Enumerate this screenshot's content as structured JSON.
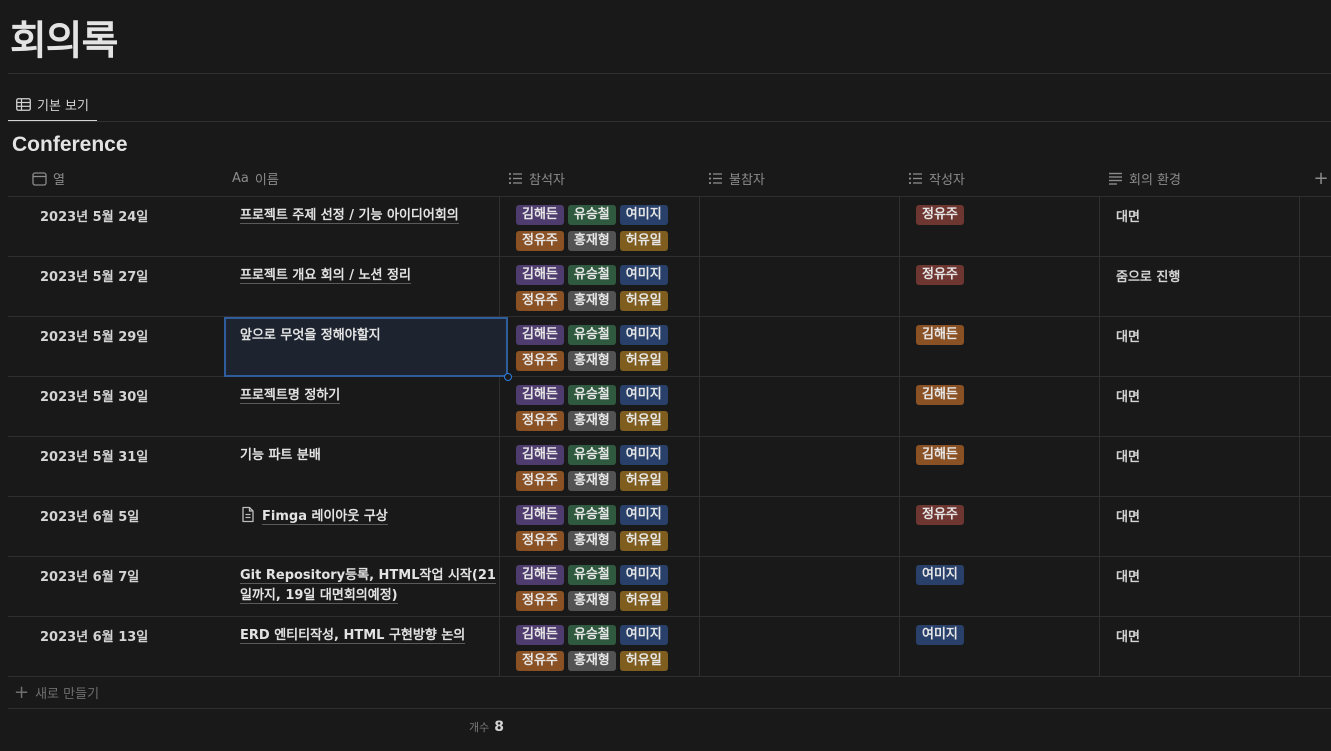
{
  "page": {
    "title": "회의록"
  },
  "tabs": [
    {
      "label": "기본 보기",
      "icon": "table-icon"
    }
  ],
  "database": {
    "title": "Conference"
  },
  "columns": [
    {
      "label": "열",
      "icon": "calendar-icon"
    },
    {
      "label": "이름",
      "icon": "text-aa-icon",
      "prefix": "Aa"
    },
    {
      "label": "참석자",
      "icon": "list-icon"
    },
    {
      "label": "불참자",
      "icon": "list-icon"
    },
    {
      "label": "작성자",
      "icon": "list-icon"
    },
    {
      "label": "회의 환경",
      "icon": "lines-icon"
    }
  ],
  "tag_colors": {
    "김해든": "#4e3c6e",
    "유승철": "#2f5a3f",
    "여미지": "#28406a",
    "정유주": "#8a5124",
    "홍재형": "#535353",
    "허유일": "#7f5d1f",
    "writer_정유주": "#6e3630",
    "writer_김해든": "#8a5124",
    "writer_여미지": "#28406a"
  },
  "rows": [
    {
      "date": "2023년 5월 24일",
      "name": "프로젝트 주제 선정 / 기능 아이디어회의",
      "attendees": [
        "김해든",
        "유승철",
        "여미지",
        "정유주",
        "홍재형",
        "허유일"
      ],
      "absentees": [],
      "writer": "정유주",
      "environment": "대면"
    },
    {
      "date": "2023년 5월 27일",
      "name": "프로젝트 개요 회의 / 노션 정리",
      "attendees": [
        "김해든",
        "유승철",
        "여미지",
        "정유주",
        "홍재형",
        "허유일"
      ],
      "absentees": [],
      "writer": "정유주",
      "environment": "줌으로 진행"
    },
    {
      "date": "2023년 5월 29일",
      "name": "앞으로 무엇을 정해야할지",
      "attendees": [
        "김해든",
        "유승철",
        "여미지",
        "정유주",
        "홍재형",
        "허유일"
      ],
      "absentees": [],
      "writer": "김해든",
      "environment": "대면"
    },
    {
      "date": "2023년 5월 30일",
      "name": "프로젝트명 정하기",
      "attendees": [
        "김해든",
        "유승철",
        "여미지",
        "정유주",
        "홍재형",
        "허유일"
      ],
      "absentees": [],
      "writer": "김해든",
      "environment": "대면"
    },
    {
      "date": "2023년 5월 31일",
      "name": "기능 파트 분배",
      "attendees": [
        "김해든",
        "유승철",
        "여미지",
        "정유주",
        "홍재형",
        "허유일"
      ],
      "absentees": [],
      "writer": "김해든",
      "environment": "대면"
    },
    {
      "date": "2023년 6월 5일",
      "name": "Fimga 레이아웃 구상",
      "attendees": [
        "김해든",
        "유승철",
        "여미지",
        "정유주",
        "홍재형",
        "허유일"
      ],
      "absentees": [],
      "writer": "정유주",
      "environment": "대면"
    },
    {
      "date": "2023년 6월 7일",
      "name": "Git Repository등록, HTML작업 시작(21일까지, 19일 대면회의예정)",
      "attendees": [
        "김해든",
        "유승철",
        "여미지",
        "정유주",
        "홍재형",
        "허유일"
      ],
      "absentees": [],
      "writer": "여미지",
      "environment": "대면"
    },
    {
      "date": "2023년 6월 13일",
      "name": "ERD 엔티티작성, HTML 구현방향 논의",
      "attendees": [
        "김해든",
        "유승철",
        "여미지",
        "정유주",
        "홍재형",
        "허유일"
      ],
      "absentees": [],
      "writer": "여미지",
      "environment": "대면"
    }
  ],
  "row_flags": [
    {
      "underlined": true,
      "doc_icon": false,
      "selected": false
    },
    {
      "underlined": true,
      "doc_icon": false,
      "selected": false
    },
    {
      "underlined": false,
      "doc_icon": false,
      "selected": true
    },
    {
      "underlined": true,
      "doc_icon": false,
      "selected": false
    },
    {
      "underlined": false,
      "doc_icon": false,
      "selected": false
    },
    {
      "underlined": true,
      "doc_icon": true,
      "selected": false
    },
    {
      "underlined": true,
      "doc_icon": false,
      "selected": false
    },
    {
      "underlined": true,
      "doc_icon": false,
      "selected": false
    }
  ],
  "footer": {
    "new_label": "새로 만들기",
    "count_label": "개수",
    "count_value": "8"
  }
}
